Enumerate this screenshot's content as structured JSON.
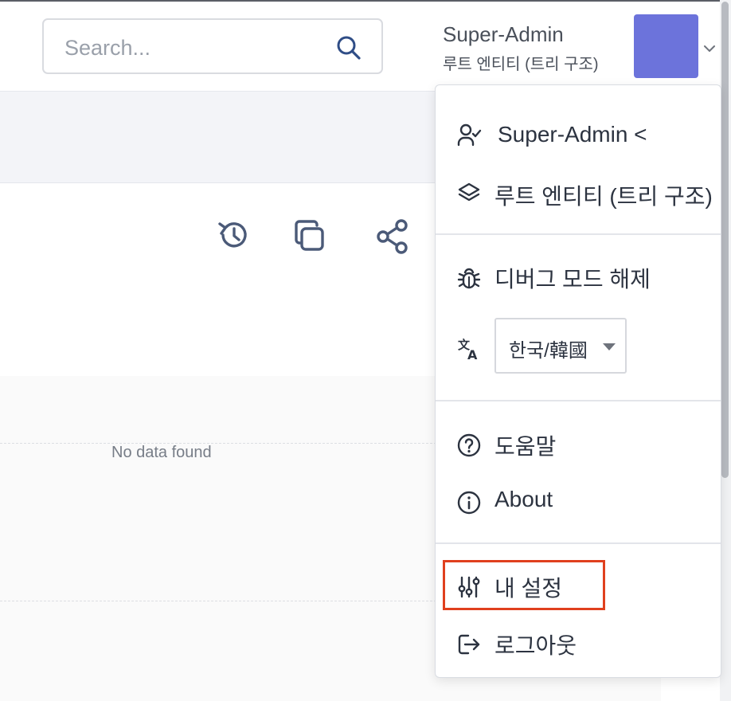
{
  "search": {
    "placeholder": "Search..."
  },
  "user": {
    "name": "Super-Admin",
    "entity": "루트 엔티티 (트리 구조)"
  },
  "colors": {
    "avatar": "#6c73db",
    "highlight": "#e0401e"
  },
  "toolbar": {
    "icons": [
      "history-icon",
      "copy-icon",
      "share-icon"
    ]
  },
  "table": {
    "empty_text": "No data found"
  },
  "menu": {
    "profile_label": "Super-Admin <",
    "entity_label": "루트 엔티티 (트리 구조)",
    "debug_label": "디버그 모드 해제",
    "language_value": "한국/韓國",
    "help_label": "도움말",
    "about_label": "About",
    "settings_label": "내 설정",
    "logout_label": "로그아웃"
  }
}
